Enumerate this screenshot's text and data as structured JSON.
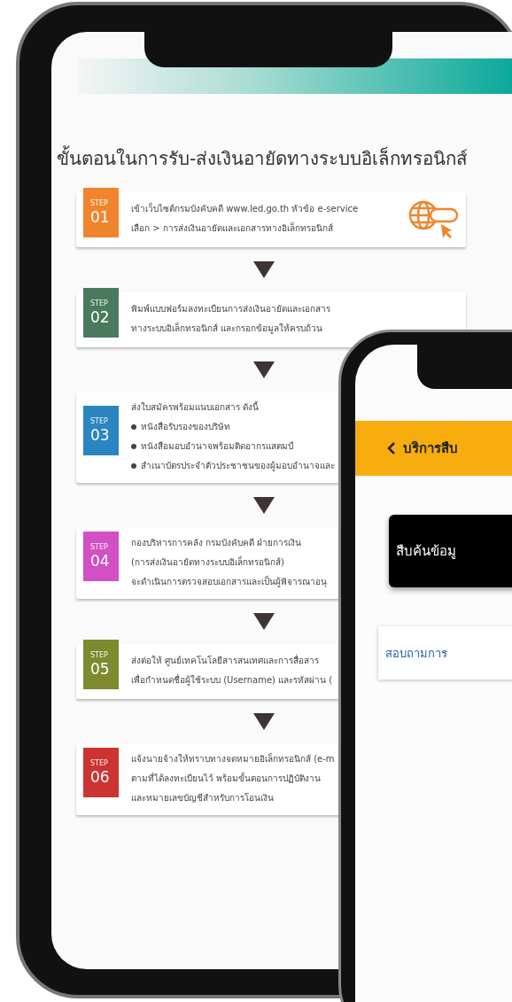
{
  "back_screen": {
    "title": "ขั้นตอนในการรับ-ส่งเงินอายัดทางระบบอิเล็กทรอนิกส์",
    "steps": [
      {
        "label": "STEP",
        "number": "01",
        "color": "#f0852d",
        "lines": [
          "เข้าเว็บไซต์กรมบังคับคดี www.led.go.th หัวข้อ e-service",
          "เลือก > การส่งเงินอายัดและเอกสารทางอิเล็กทรอนิกส์"
        ]
      },
      {
        "label": "STEP",
        "number": "02",
        "color": "#4a7a5e",
        "lines": [
          "พิมพ์แบบฟอร์มลงทะเบียนการส่งเงินอายัดและเอกสาร",
          "ทางระบบอิเล็กทรอนิกส์ และกรอกข้อมูลให้ครบถ้วน"
        ]
      },
      {
        "label": "STEP",
        "number": "03",
        "color": "#2a86c0",
        "lines": [
          "ส่งใบสมัครพร้อมแนบเอกสาร ดังนี้"
        ],
        "bullets": [
          "หนังสือรับรองของบริษัท",
          "หนังสือมอบอำนาจพร้อมติดอากรแสตมป์",
          "สำเนาบัตรประจำตัวประชาชนของผู้มอบอำนาจและ"
        ]
      },
      {
        "label": "STEP",
        "number": "04",
        "color": "#d24fc4",
        "lines": [
          "กองบริหารการคลัง กรมบังคับคดี ฝ่ายการเงิน",
          "(การส่งเงินอายัดทางระบบอิเล็กทรอนิกส์)",
          "จะดำเนินการตรวจสอบเอกสารและเป็นผู้พิจารณาอนุ"
        ]
      },
      {
        "label": "STEP",
        "number": "05",
        "color": "#7d8a2e",
        "lines": [
          "ส่งต่อให้ ศูนย์เทคโนโลยีสารสนเทศและการสื่อสาร",
          "เพื่อกำหนดชื่อผู้ใช้ระบบ (Username) และรหัสผ่าน ("
        ]
      },
      {
        "label": "STEP",
        "number": "06",
        "color": "#cc3333",
        "lines": [
          "แจ้งนายจ้างให้ทราบทางจดหมายอิเล็กทรอนิกส์ (e-m",
          "ตามที่ได้ลงทะเบียนไว้ พร้อมขั้นตอนการปฏิบัติงาน",
          "และหมายเลขบัญชีสำหรับการโอนเงิน"
        ]
      }
    ]
  },
  "front_screen": {
    "header": "บริการสืบ",
    "search_button": "สืบค้นข้อมู",
    "inquiry_link": "สอบถามการ"
  }
}
